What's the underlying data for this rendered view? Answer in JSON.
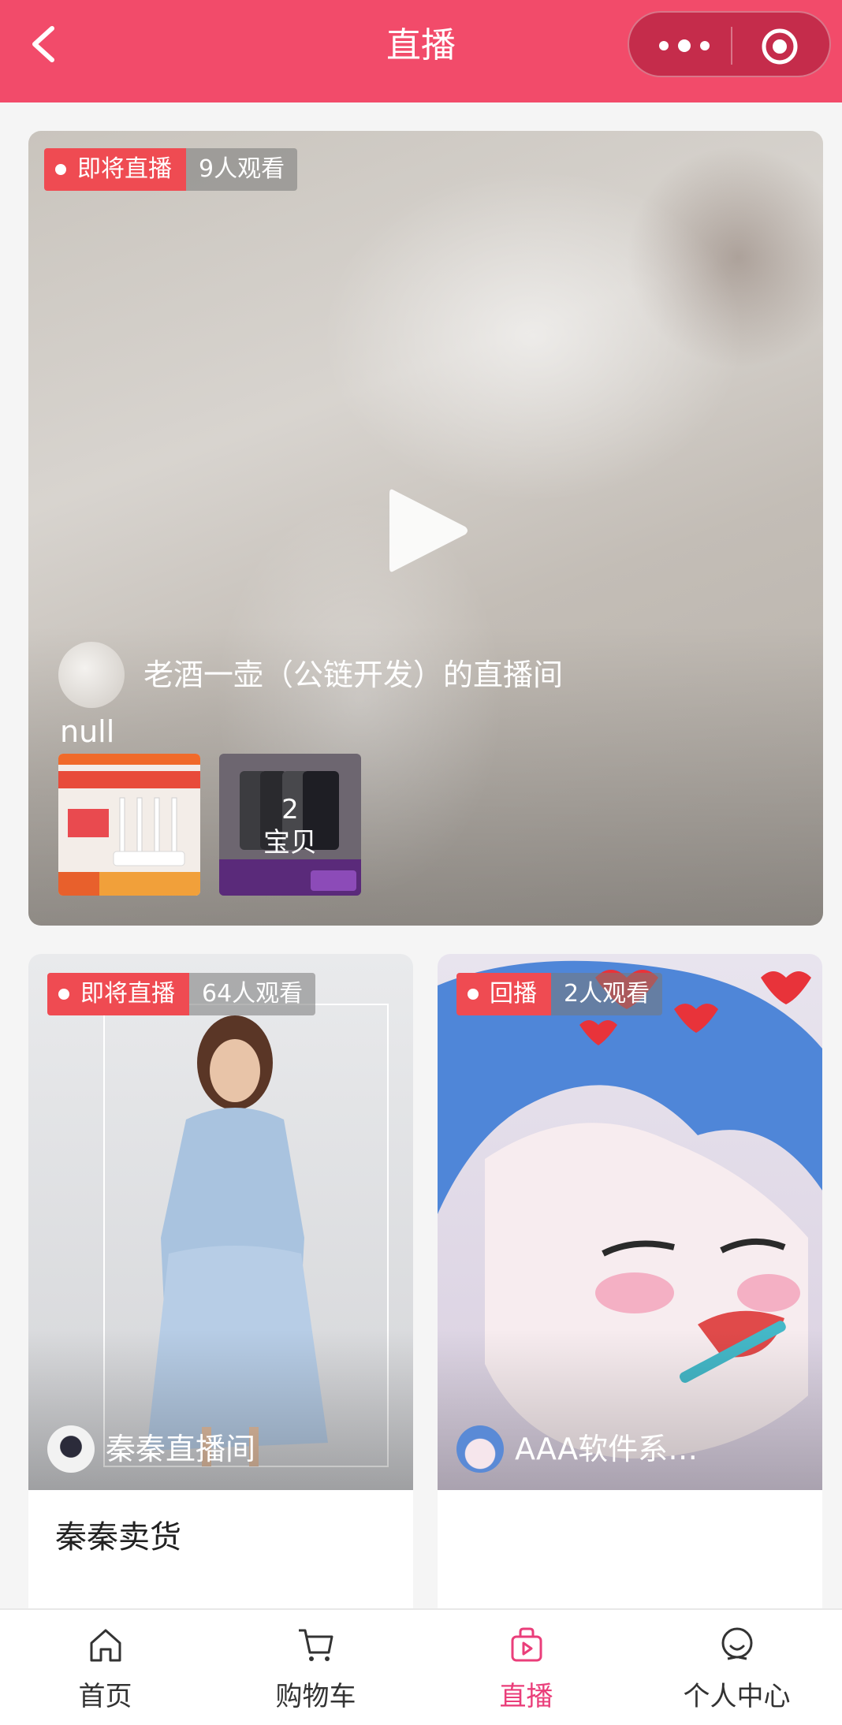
{
  "header": {
    "title": "直播"
  },
  "featured": {
    "status": "即将直播",
    "viewers": "9人观看",
    "room_name": "老酒一壶（公链开发）的直播间",
    "description": "null",
    "product_count": "2",
    "product_unit": "宝贝"
  },
  "rooms": [
    {
      "status": "即将直播",
      "viewers": "64人观看",
      "room_name": "秦秦直播间",
      "title": "秦秦卖货"
    },
    {
      "status": "回播",
      "viewers": "2人观看",
      "room_name": "AAA软件系…",
      "title": ""
    }
  ],
  "tabbar": [
    {
      "label": "首页",
      "icon": "home-icon"
    },
    {
      "label": "购物车",
      "icon": "cart-icon"
    },
    {
      "label": "直播",
      "icon": "live-icon"
    },
    {
      "label": "个人中心",
      "icon": "profile-icon"
    }
  ],
  "colors": {
    "brand": "#f24b6a",
    "status": "#ef4b52",
    "tab_active": "#ea3e7a"
  }
}
